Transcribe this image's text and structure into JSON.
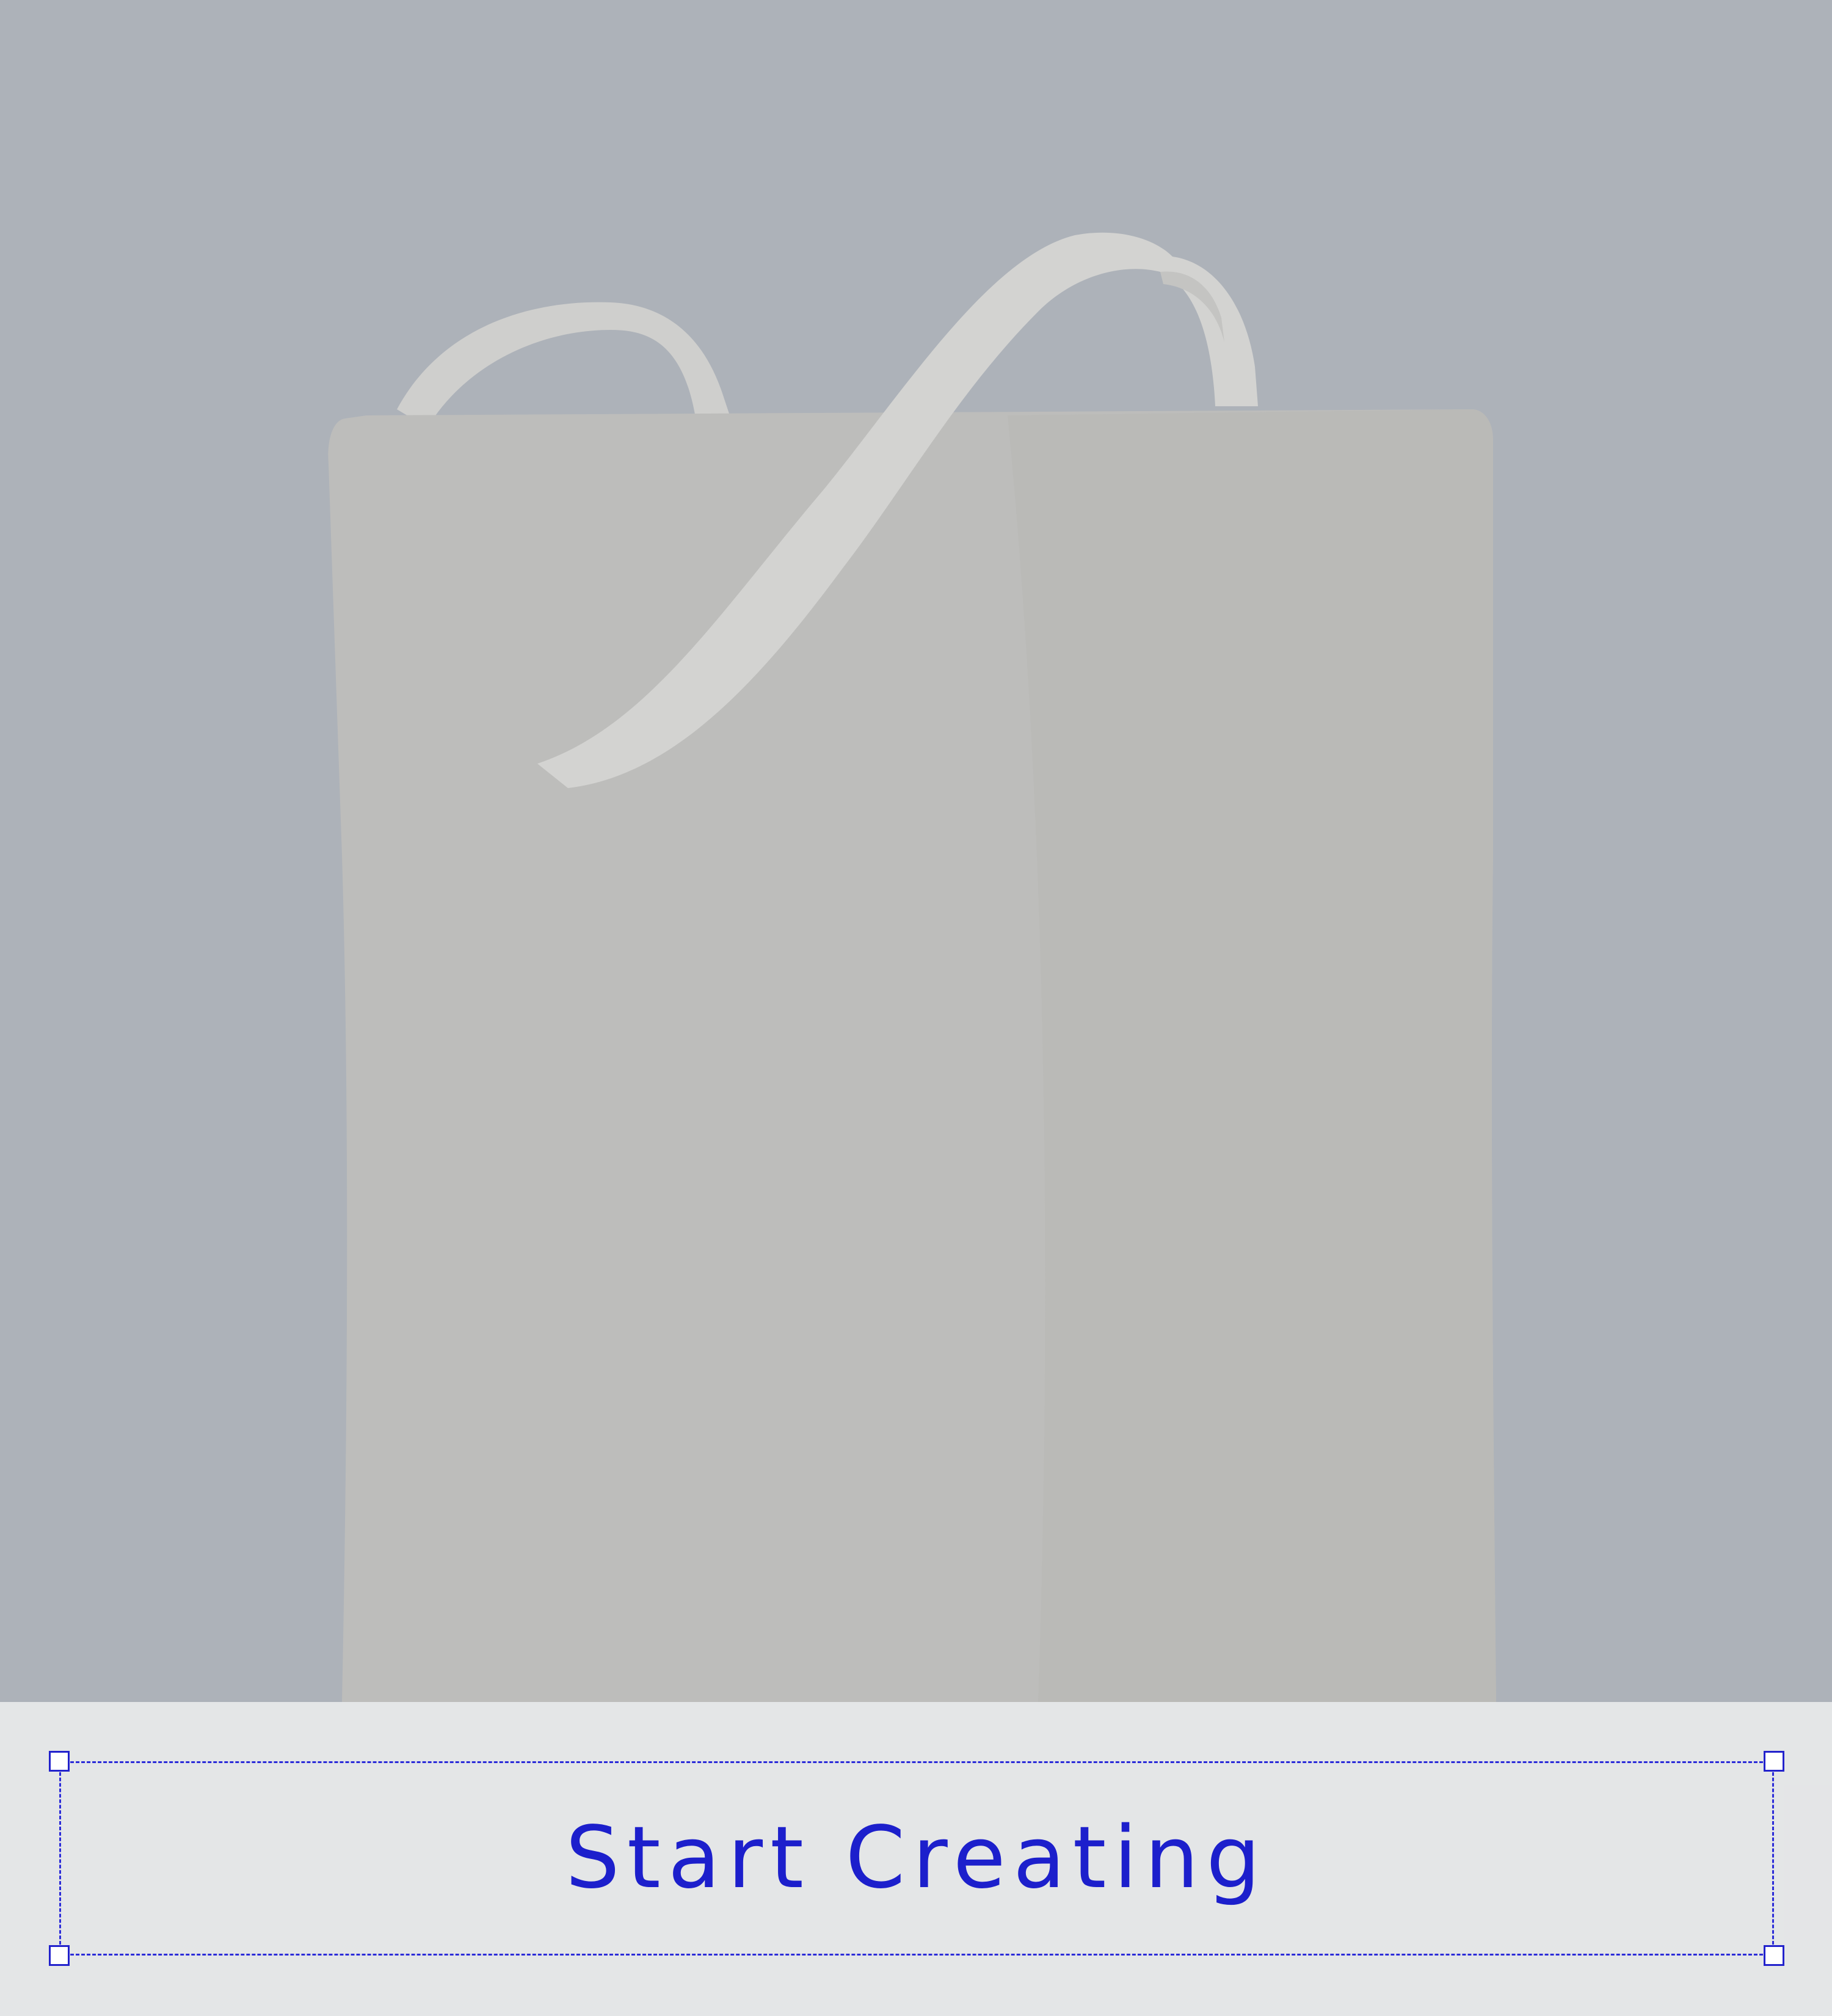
{
  "canvas": {
    "background_color": "#adb2b9",
    "product": "tote-bag",
    "product_color": "#bdbdbb"
  },
  "cta": {
    "label": "Start Creating",
    "color": "#1c1fcc",
    "selection_color": "#2b2bd8"
  },
  "panel": {
    "color": "#e8e9eb"
  }
}
